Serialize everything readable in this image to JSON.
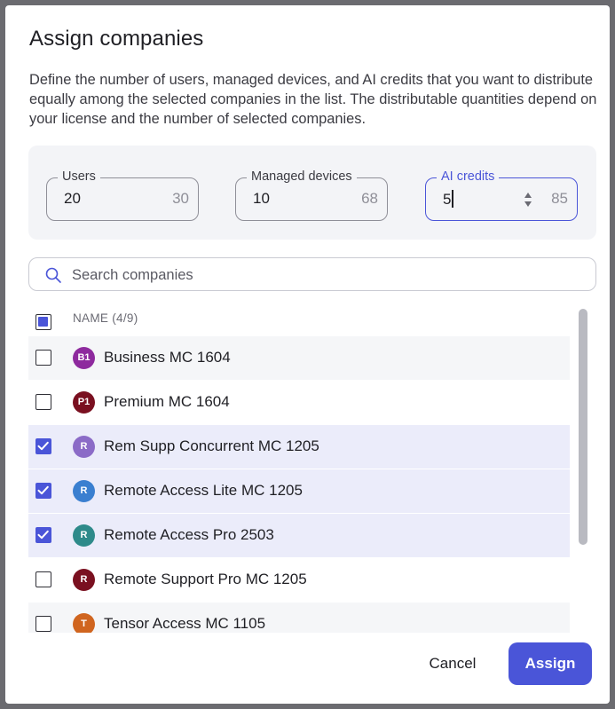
{
  "dialog": {
    "title": "Assign companies",
    "description": "Define the number of users, managed devices, and AI credits that you want to distribute equally among the selected companies in the list. The distributable quantities depend on your license and the number of selected companies."
  },
  "quantities": {
    "users": {
      "label": "Users",
      "value": "20",
      "max": "30"
    },
    "managed_devices": {
      "label": "Managed devices",
      "value": "10",
      "max": "68"
    },
    "ai_credits": {
      "label": "AI credits",
      "value": "5",
      "max": "85"
    }
  },
  "search": {
    "placeholder": "Search companies",
    "value": ""
  },
  "list": {
    "header": "NAME (4/9)",
    "rows": [
      {
        "initials": "B1",
        "name": "Business MC 1604",
        "checked": false,
        "avatar_color": "#8e2a9e"
      },
      {
        "initials": "P1",
        "name": "Premium MC 1604",
        "checked": false,
        "avatar_color": "#7a1020"
      },
      {
        "initials": "R",
        "name": "Rem Supp Concurrent MC 1205",
        "checked": true,
        "avatar_color": "#8b6bc7"
      },
      {
        "initials": "R",
        "name": "Remote Access Lite MC 1205",
        "checked": true,
        "avatar_color": "#3a7fd0"
      },
      {
        "initials": "R",
        "name": "Remote Access Pro 2503",
        "checked": true,
        "avatar_color": "#2e8a8a"
      },
      {
        "initials": "R",
        "name": "Remote Support Pro MC 1205",
        "checked": false,
        "avatar_color": "#7a1020"
      },
      {
        "initials": "T",
        "name": "Tensor Access MC 1105",
        "checked": false,
        "avatar_color": "#d0651f"
      }
    ]
  },
  "footer": {
    "cancel_label": "Cancel",
    "assign_label": "Assign"
  },
  "colors": {
    "accent": "#4a55d8",
    "selected_row": "#ebecfa",
    "alt_row": "#f5f6f8"
  }
}
